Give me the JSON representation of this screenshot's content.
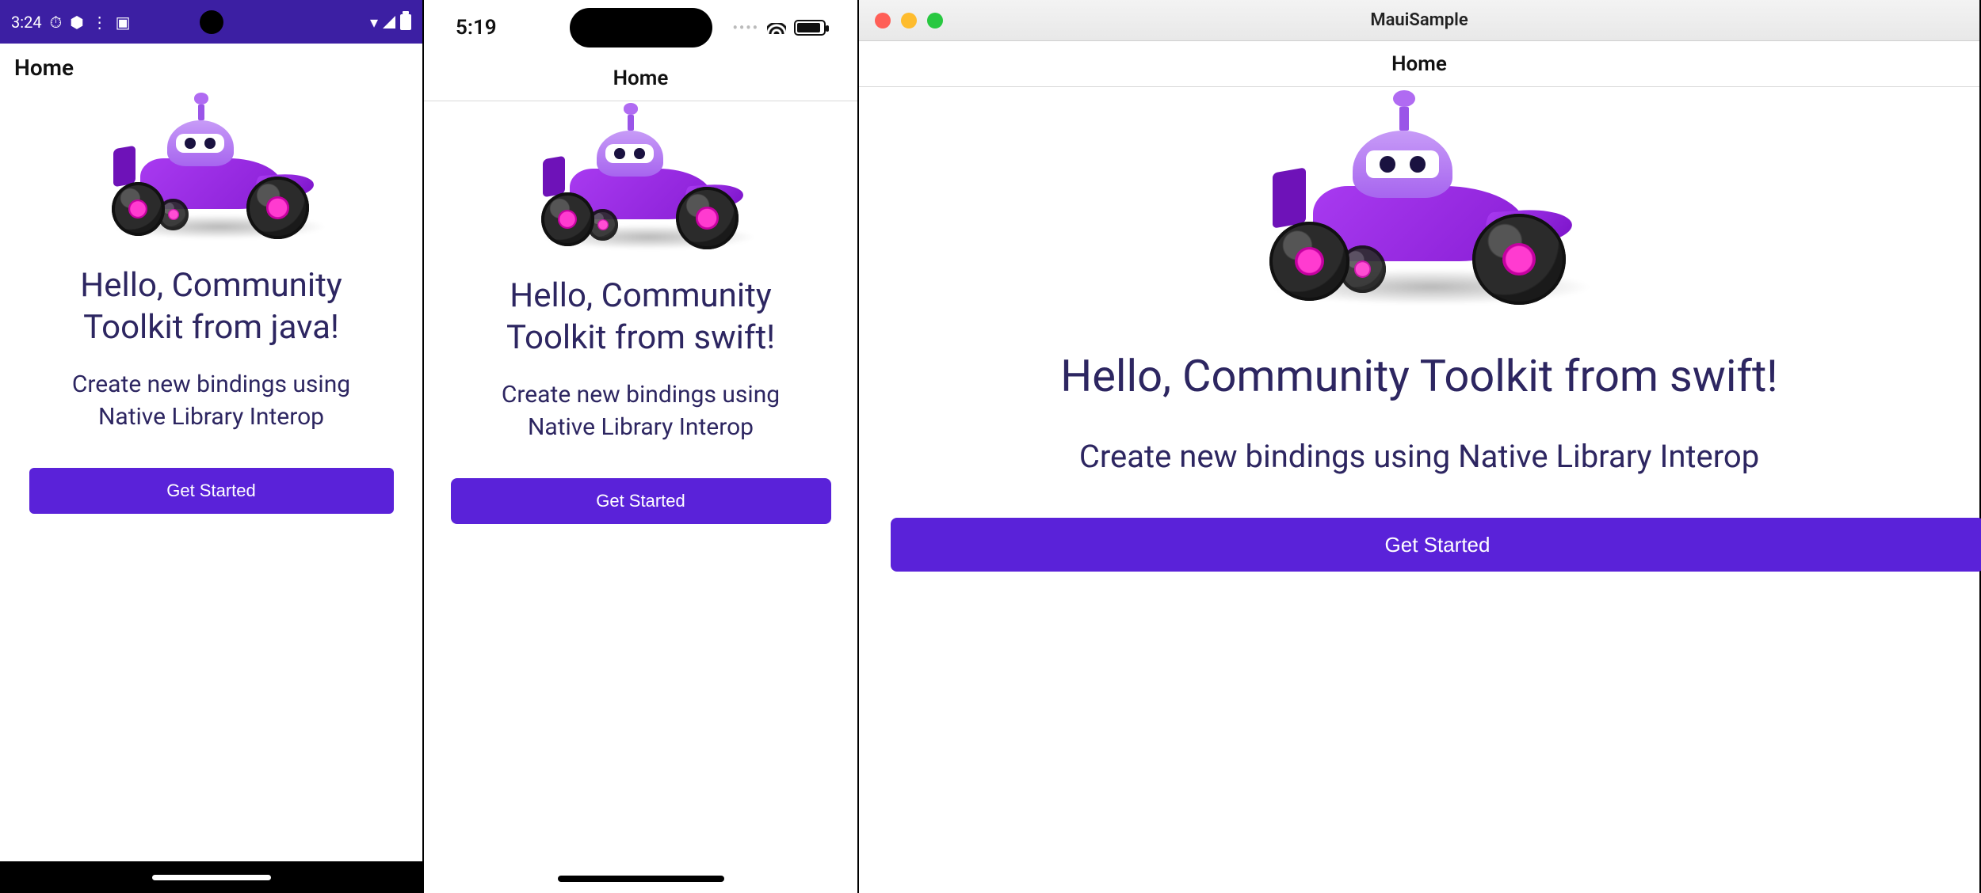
{
  "colors": {
    "primary": "#5a22d9",
    "heading": "#2d2661"
  },
  "android": {
    "status_time": "3:24",
    "appbar_title": "Home",
    "hero_title_l1": "Hello, Community",
    "hero_title_l2": "Toolkit from java!",
    "hero_sub_l1": "Create new bindings using",
    "hero_sub_l2": "Native Library Interop",
    "cta_label": "Get Started"
  },
  "ios": {
    "status_time": "5:19",
    "appbar_title": "Home",
    "hero_title_l1": "Hello, Community",
    "hero_title_l2": "Toolkit from swift!",
    "hero_sub_l1": "Create new bindings using",
    "hero_sub_l2": "Native Library Interop",
    "cta_label": "Get Started"
  },
  "mac": {
    "window_title": "MauiSample",
    "appbar_title": "Home",
    "hero_title": "Hello, Community Toolkit from swift!",
    "hero_sub": "Create new bindings using Native Library Interop",
    "cta_label": "Get Started"
  }
}
